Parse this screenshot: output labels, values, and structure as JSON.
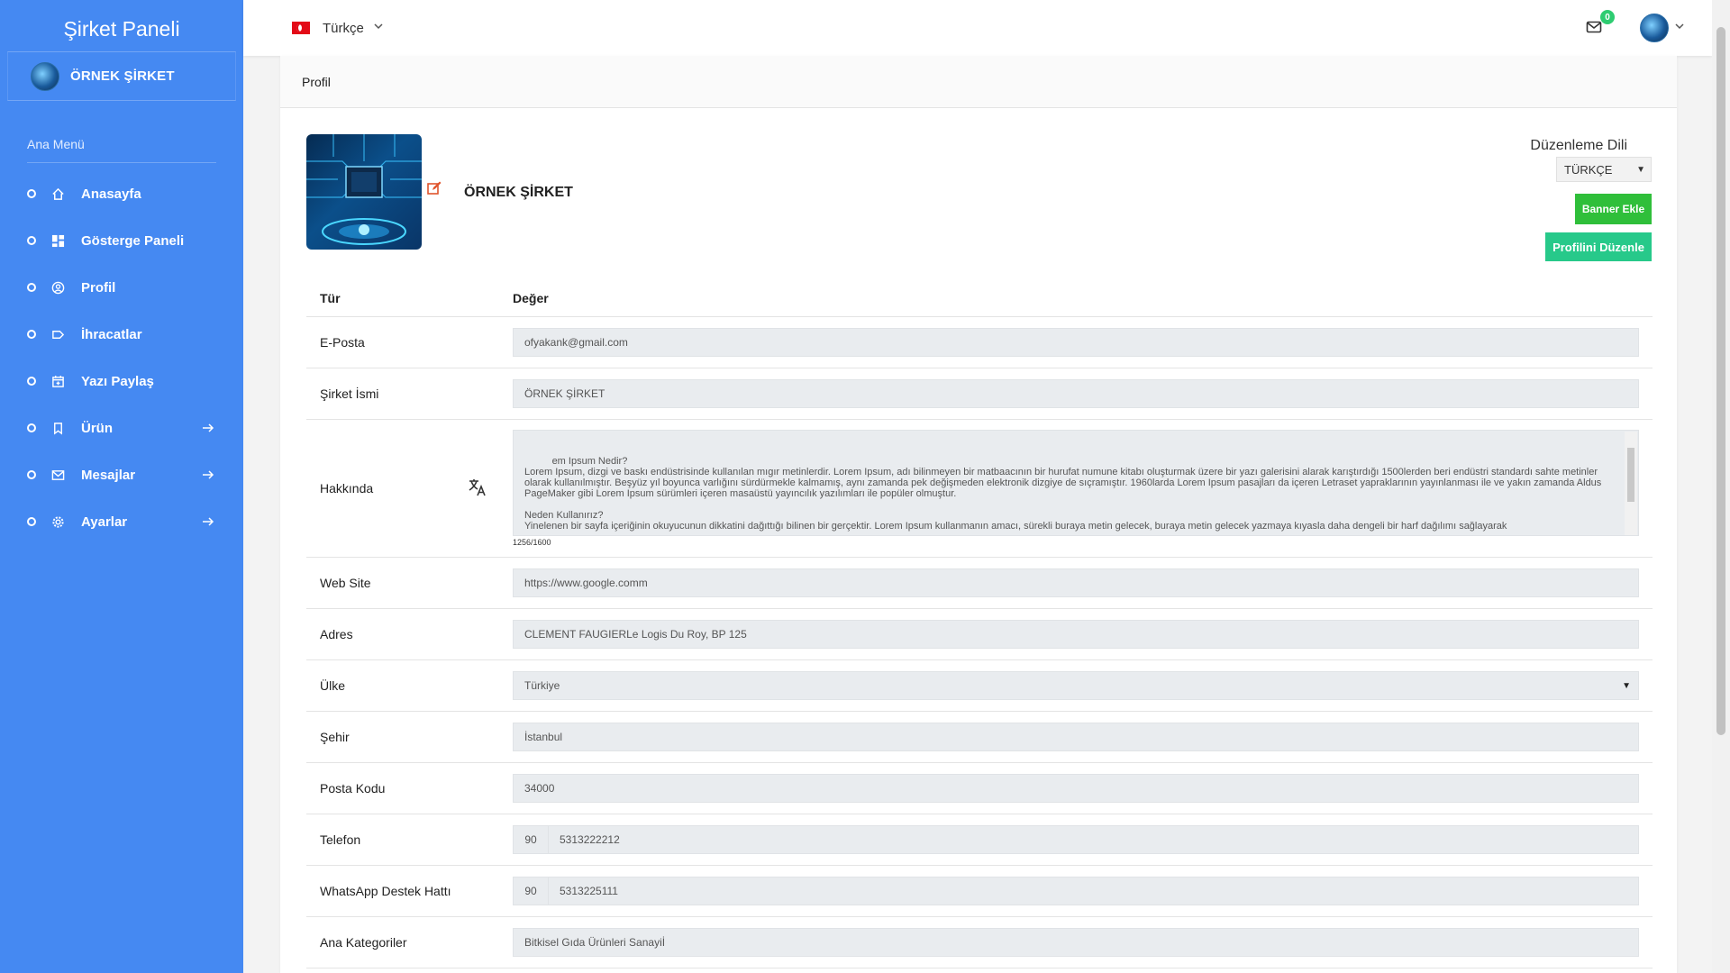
{
  "sidebar": {
    "brand": "Şirket Paneli",
    "company": "ÖRNEK ŞİRKET",
    "menu_title": "Ana Menü",
    "items": [
      {
        "label": "Anasayfa",
        "icon": "home-icon"
      },
      {
        "label": "Gösterge Paneli",
        "icon": "dashboard-icon"
      },
      {
        "label": "Profil",
        "icon": "user-circle-icon"
      },
      {
        "label": "İhracatlar",
        "icon": "tag-icon"
      },
      {
        "label": "Yazı Paylaş",
        "icon": "calendar-plus-icon"
      },
      {
        "label": "Ürün",
        "icon": "bookmark-icon",
        "arrow": true
      },
      {
        "label": "Mesajlar",
        "icon": "mail-icon",
        "arrow": true
      },
      {
        "label": "Ayarlar",
        "icon": "gear-icon",
        "arrow": true
      }
    ]
  },
  "topbar": {
    "language": "Türkçe",
    "mail_count": "0"
  },
  "card": {
    "title": "Profil",
    "company_name": "ÖRNEK ŞİRKET",
    "edit_language_label": "Düzenleme Dili",
    "edit_language_value": "TÜRKÇE",
    "banner_button": "Banner Ekle",
    "edit_profile_button": "Profilini Düzenle"
  },
  "table": {
    "col_type": "Tür",
    "col_value": "Değer",
    "email_label": "E-Posta",
    "email_value": "ofyakank@gmail.com",
    "company_label": "Şirket İsmi",
    "company_value": "ÖRNEK ŞİRKET",
    "about_label": "Hakkında",
    "about_value": "em Ipsum Nedir?\nLorem Ipsum, dizgi ve baskı endüstrisinde kullanılan mıgır metinlerdir. Lorem Ipsum, adı bilinmeyen bir matbaacının bir hurufat numune kitabı oluşturmak üzere bir yazı galerisini alarak karıştırdığı 1500lerden beri endüstri standardı sahte metinler olarak kullanılmıştır. Beşyüz yıl boyunca varlığını sürdürmekle kalmamış, aynı zamanda pek değişmeden elektronik dizgiye de sıçramıştır. 1960larda Lorem Ipsum pasajları da içeren Letraset yapraklarının yayınlanması ile ve yakın zamanda Aldus PageMaker gibi Lorem Ipsum sürümleri içeren masaüstü yayıncılık yazılımları ile popüler olmuştur.\n\nNeden Kullanırız?\nYinelenen bir sayfa içeriğinin okuyucunun dikkatini dağıttığı bilinen bir gerçektir. Lorem Ipsum kullanmanın amacı, sürekli buraya metin gelecek, buraya metin gelecek yazmaya kıyasla daha dengeli bir harf dağılımı sağlayarak",
    "about_count": "1256/1600",
    "web_label": "Web Site",
    "web_value": "https://www.google.comm",
    "address_label": "Adres",
    "address_value": "CLEMENT FAUGIERLe Logis Du Roy, BP 125",
    "country_label": "Ülke",
    "country_value": "Türkiye",
    "city_label": "Şehir",
    "city_value": "İstanbul",
    "zip_label": "Posta Kodu",
    "zip_value": "34000",
    "phone_label": "Telefon",
    "phone_code": "90",
    "phone_value": "5313222212",
    "whatsapp_label": "WhatsApp Destek Hattı",
    "whatsapp_code": "90",
    "whatsapp_value": "5313225111",
    "category_label": "Ana Kategoriler",
    "category_value": "Bitkisel Gıda Ürünleri Sanayiİ"
  }
}
